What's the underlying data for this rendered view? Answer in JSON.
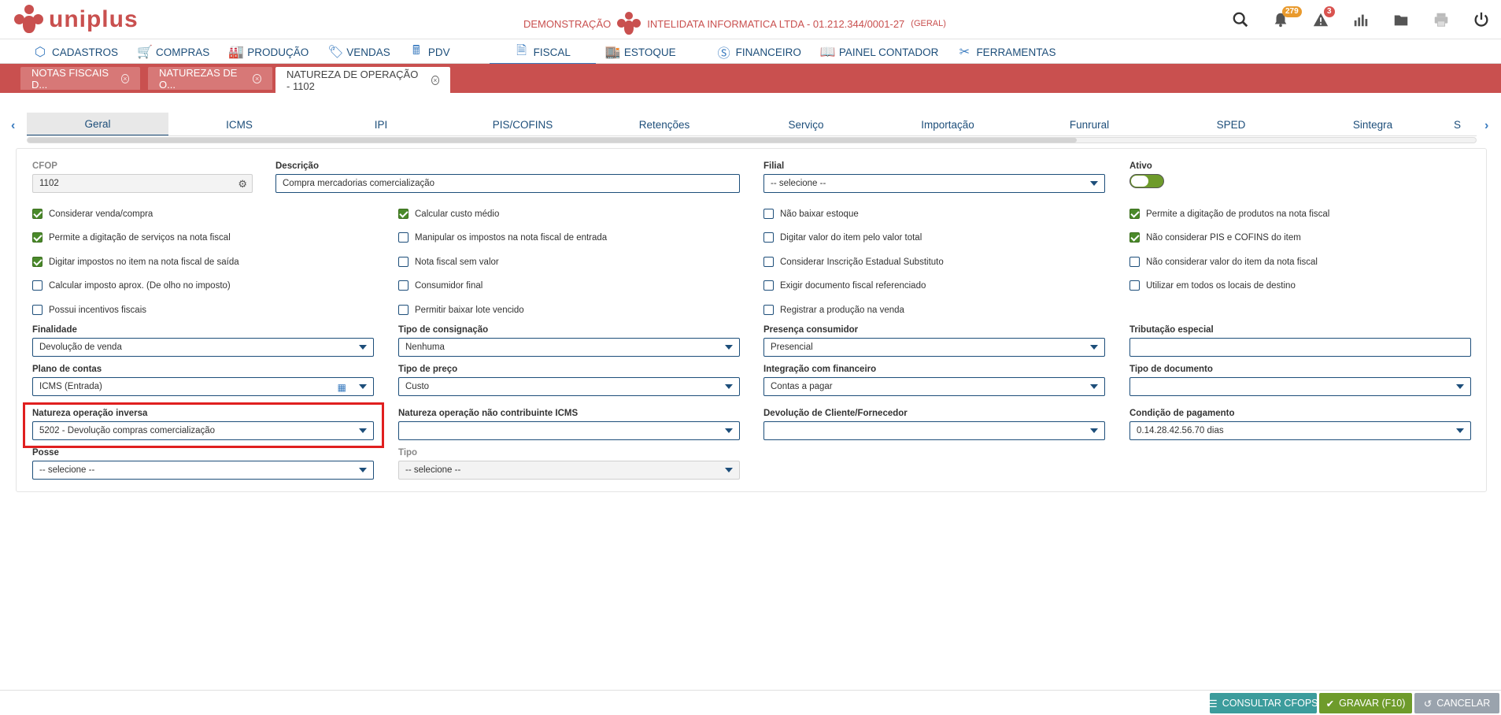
{
  "header": {
    "brand": "uniplus",
    "environment": "DEMONSTRAÇÃO",
    "company": "INTELIDATA INFORMATICA LTDA - 01.212.344/0001-27",
    "company_scope": "(GERAL)",
    "notifications_count": "279",
    "alerts_count": "3"
  },
  "mainnav": {
    "items": [
      {
        "label": "CADASTROS",
        "icon": "hexagon-icon"
      },
      {
        "label": "COMPRAS",
        "icon": "cart-icon"
      },
      {
        "label": "PRODUÇÃO",
        "icon": "factory-icon"
      },
      {
        "label": "VENDAS",
        "icon": "tag-icon"
      },
      {
        "label": "PDV",
        "icon": "register-icon"
      },
      {
        "label": "FISCAL",
        "icon": "document-icon"
      },
      {
        "label": "ESTOQUE",
        "icon": "warehouse-icon"
      },
      {
        "label": "FINANCEIRO",
        "icon": "dollar-icon"
      },
      {
        "label": "PAINEL CONTADOR",
        "icon": "book-icon"
      },
      {
        "label": "FERRAMENTAS",
        "icon": "tools-icon"
      }
    ],
    "active": "FISCAL"
  },
  "doc_tabs": [
    {
      "label": "NOTAS FISCAIS D..."
    },
    {
      "label": "NATUREZAS DE O..."
    },
    {
      "label": "NATUREZA DE OPERAÇÃO - 1102"
    }
  ],
  "subtabs": [
    "Geral",
    "ICMS",
    "IPI",
    "PIS/COFINS",
    "Retenções",
    "Serviço",
    "Importação",
    "Funrural",
    "SPED",
    "Sintegra",
    "S"
  ],
  "form": {
    "cfop": {
      "label": "CFOP",
      "value": "1102"
    },
    "descricao": {
      "label": "Descrição",
      "value": "Compra mercadorias comercialização"
    },
    "filial": {
      "label": "Filial",
      "value": "-- selecione --"
    },
    "ativo": {
      "label": "Ativo"
    },
    "checkboxes": [
      {
        "label": "Considerar venda/compra",
        "checked": true
      },
      {
        "label": "Calcular custo médio",
        "checked": true
      },
      {
        "label": "Não baixar estoque",
        "checked": false
      },
      {
        "label": "Permite a digitação de produtos na nota fiscal",
        "checked": true
      },
      {
        "label": "Permite a digitação de serviços na nota fiscal",
        "checked": true
      },
      {
        "label": "Manipular os impostos na nota fiscal de entrada",
        "checked": false
      },
      {
        "label": "Digitar valor do item pelo valor total",
        "checked": false
      },
      {
        "label": "Não considerar PIS e COFINS do item",
        "checked": true
      },
      {
        "label": "Digitar impostos no item na nota fiscal de saída",
        "checked": true
      },
      {
        "label": "Nota fiscal sem valor",
        "checked": false
      },
      {
        "label": "Considerar Inscrição Estadual Substituto",
        "checked": false
      },
      {
        "label": "Não considerar valor do item da nota fiscal",
        "checked": false
      },
      {
        "label": "Calcular imposto aprox. (De olho no imposto)",
        "checked": false
      },
      {
        "label": "Consumidor final",
        "checked": false
      },
      {
        "label": "Exigir documento fiscal referenciado",
        "checked": false
      },
      {
        "label": "Utilizar em todos os locais de destino",
        "checked": false
      },
      {
        "label": "Possui incentivos fiscais",
        "checked": false
      },
      {
        "label": "Permitir baixar lote vencido",
        "checked": false
      },
      {
        "label": "Registrar a produção na venda",
        "checked": false
      }
    ],
    "finalidade": {
      "label": "Finalidade",
      "value": "Devolução de venda"
    },
    "tipo_consignacao": {
      "label": "Tipo de consignação",
      "value": "Nenhuma"
    },
    "presenca_consumidor": {
      "label": "Presença consumidor",
      "value": "Presencial"
    },
    "tributacao_especial": {
      "label": "Tributação especial",
      "value": ""
    },
    "plano_contas": {
      "label": "Plano de contas",
      "value": "ICMS (Entrada)"
    },
    "tipo_preco": {
      "label": "Tipo de preço",
      "value": "Custo"
    },
    "integracao_financeiro": {
      "label": "Integração com financeiro",
      "value": "Contas a pagar"
    },
    "tipo_documento": {
      "label": "Tipo de documento",
      "value": ""
    },
    "natureza_inversa": {
      "label": "Natureza operação inversa",
      "value": "5202 - Devolução compras comercialização"
    },
    "natureza_nao_contribuinte": {
      "label": "Natureza operação não contribuinte ICMS",
      "value": ""
    },
    "devolucao_cliente": {
      "label": "Devolução de Cliente/Fornecedor",
      "value": ""
    },
    "condicao_pagamento": {
      "label": "Condição de pagamento",
      "value": "0.14.28.42.56.70 dias"
    },
    "posse": {
      "label": "Posse",
      "value": "-- selecione --"
    },
    "tipo": {
      "label": "Tipo",
      "value": "-- selecione --"
    }
  },
  "footer": {
    "consultar": "CONSULTAR CFOPS",
    "gravar": "GRAVAR (F10)",
    "cancelar": "CANCELAR"
  },
  "colors": {
    "brand": "#c9504f",
    "nav_text": "#1d4e7a",
    "checked": "#4a8a2a",
    "highlight": "#e01f1f"
  }
}
